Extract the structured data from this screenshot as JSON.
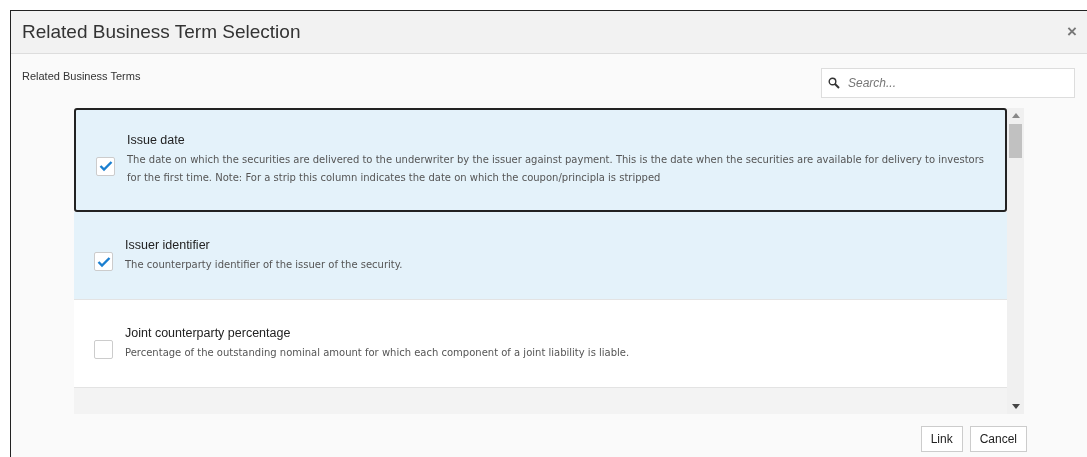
{
  "dialog": {
    "title": "Related Business Term Selection",
    "close": "×"
  },
  "section_label": "Related Business Terms",
  "search": {
    "placeholder": "Search..."
  },
  "terms": [
    {
      "name": "Issue date",
      "description": "The date on which the securities are delivered to the underwriter by the issuer against payment. This is the date when the securities are available for delivery to investors for the first time. Note: For a strip this column indicates the date on which the coupon/principla is stripped",
      "checked": true,
      "focused": true
    },
    {
      "name": "Issuer identifier",
      "description": "The counterparty identifier of the issuer of the security.",
      "checked": true,
      "focused": false
    },
    {
      "name": "Joint counterparty percentage",
      "description": "Percentage of the outstanding nominal amount for which each component of a joint liability is liable.",
      "checked": false,
      "focused": false
    }
  ],
  "buttons": [
    "Link",
    "Cancel"
  ]
}
